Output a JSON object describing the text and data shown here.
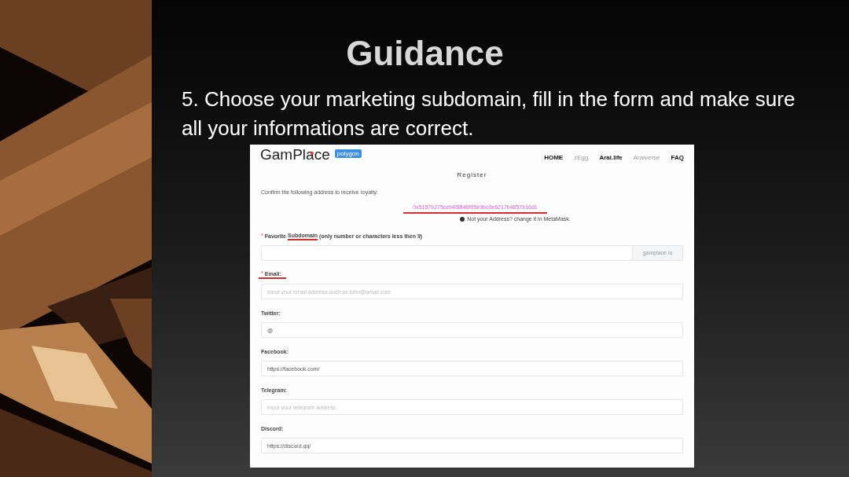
{
  "slide": {
    "title": "Guidance",
    "instruction": "5. Choose your marketing subdomain, fill in the form and make sure all your informations are correct."
  },
  "site": {
    "logo": "GamPlace",
    "network_badge": "polygon",
    "nav": [
      {
        "label": "HOME",
        "muted": false
      },
      {
        "label": "zEgg",
        "muted": true
      },
      {
        "label": "Arai.life",
        "muted": false
      },
      {
        "label": "Araiverse",
        "muted": true
      },
      {
        "label": "FAQ",
        "muted": false
      }
    ],
    "heading": "Register",
    "confirm_text": "Confirm the following address to receive royalty:",
    "address": {
      "text": "0x5157b275ceb4f8846f05e9bc0e6217b4857b16d1",
      "underlined": true
    },
    "address_note": "Not your Address? change it in MetaMask.",
    "fields": [
      {
        "required_mark": "*",
        "label_parts": [
          {
            "text": "Favorite",
            "underlined": false
          },
          {
            "text": "Subdomain",
            "underlined": true
          },
          {
            "text": "(only number or characters less then 9)",
            "underlined": false
          }
        ],
        "label_underlined": false,
        "addon": "gamplace.io"
      },
      {
        "required_mark": "*",
        "label_parts": [
          {
            "text": "Email:",
            "underlined": false
          }
        ],
        "label_underlined": true,
        "placeholder": "Input your email address,such as john@gmail.com"
      },
      {
        "label_parts": [
          {
            "text": "Twitter:",
            "underlined": false
          }
        ],
        "label_underlined": false,
        "value": "@"
      },
      {
        "label_parts": [
          {
            "text": "Facebook:",
            "underlined": false
          }
        ],
        "label_underlined": false,
        "value": "https://facebook.com/"
      },
      {
        "label_parts": [
          {
            "text": "Telegram:",
            "underlined": false
          }
        ],
        "label_underlined": false,
        "placeholder": "Input your telegram address"
      },
      {
        "label_parts": [
          {
            "text": "Discord:",
            "underlined": false
          }
        ],
        "label_underlined": false,
        "value": "https://discord.gg/"
      }
    ]
  }
}
